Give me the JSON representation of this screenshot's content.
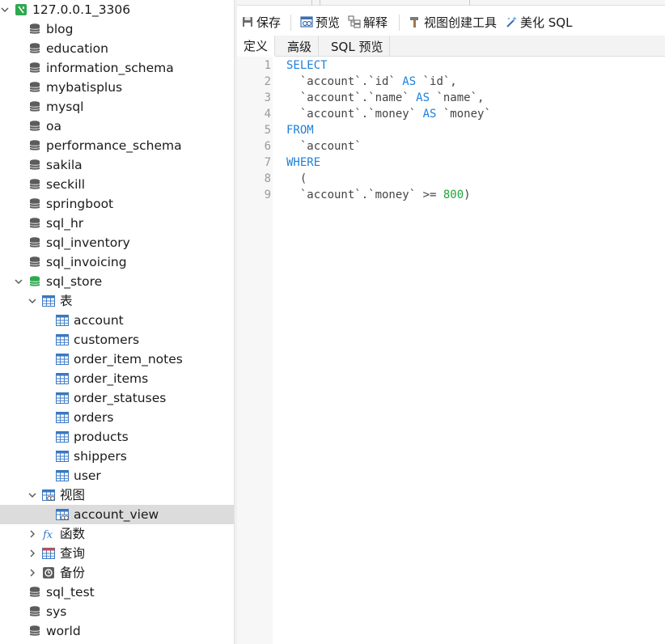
{
  "navigator": {
    "connection": {
      "label": "127.0.0.1_3306"
    },
    "databases_before": [
      {
        "label": "blog"
      },
      {
        "label": "education"
      },
      {
        "label": "information_schema"
      },
      {
        "label": "mybatisplus"
      },
      {
        "label": "mysql"
      },
      {
        "label": "oa"
      },
      {
        "label": "performance_schema"
      },
      {
        "label": "sakila"
      },
      {
        "label": "seckill"
      },
      {
        "label": "springboot"
      },
      {
        "label": "sql_hr"
      },
      {
        "label": "sql_inventory"
      },
      {
        "label": "sql_invoicing"
      }
    ],
    "open_database": {
      "label": "sql_store",
      "tables_group": {
        "label": "表",
        "tables": [
          {
            "label": "account"
          },
          {
            "label": "customers"
          },
          {
            "label": "order_item_notes"
          },
          {
            "label": "order_items"
          },
          {
            "label": "order_statuses"
          },
          {
            "label": "orders"
          },
          {
            "label": "products"
          },
          {
            "label": "shippers"
          },
          {
            "label": "user"
          }
        ]
      },
      "views_group": {
        "label": "视图",
        "views": [
          {
            "label": "account_view",
            "selected": true
          }
        ]
      },
      "functions_group": {
        "label": "函数"
      },
      "queries_group": {
        "label": "查询"
      },
      "backups_group": {
        "label": "备份"
      }
    },
    "databases_after": [
      {
        "label": "sql_test"
      },
      {
        "label": "sys"
      },
      {
        "label": "world"
      }
    ]
  },
  "toolbar": {
    "save_label": "保存",
    "preview_label": "预览",
    "explain_label": "解释",
    "view_builder_label": "视图创建工具",
    "beautify_label": "美化 SQL"
  },
  "subtabs": {
    "definition": "定义",
    "advanced": "高级",
    "sql_preview": "SQL 预览"
  },
  "editor": {
    "line_numbers": [
      "1",
      "2",
      "3",
      "4",
      "5",
      "6",
      "7",
      "8",
      "9"
    ],
    "lines": [
      [
        {
          "t": "SELECT",
          "c": "kw"
        }
      ],
      [
        {
          "t": "  `account`.`id` ",
          "c": ""
        },
        {
          "t": "AS",
          "c": "kw"
        },
        {
          "t": " `id`,",
          "c": ""
        }
      ],
      [
        {
          "t": "  `account`.`name` ",
          "c": ""
        },
        {
          "t": "AS",
          "c": "kw"
        },
        {
          "t": " `name`,",
          "c": ""
        }
      ],
      [
        {
          "t": "  `account`.`money` ",
          "c": ""
        },
        {
          "t": "AS",
          "c": "kw"
        },
        {
          "t": " `money`",
          "c": ""
        }
      ],
      [
        {
          "t": "FROM",
          "c": "kw"
        }
      ],
      [
        {
          "t": "  `account`",
          "c": ""
        }
      ],
      [
        {
          "t": "WHERE",
          "c": "kw"
        }
      ],
      [
        {
          "t": "  (",
          "c": ""
        }
      ],
      [
        {
          "t": "  `account`.`money` >= ",
          "c": ""
        },
        {
          "t": "800",
          "c": "num"
        },
        {
          "t": ")",
          "c": ""
        }
      ]
    ]
  },
  "colors": {
    "keyword": "#1e7fdb",
    "number": "#22a33a",
    "selection": "#dcdcdc",
    "db_icon": "#5c5c5c",
    "open_db_icon": "#2fa84f",
    "connection_icon": "#2fa84f"
  }
}
